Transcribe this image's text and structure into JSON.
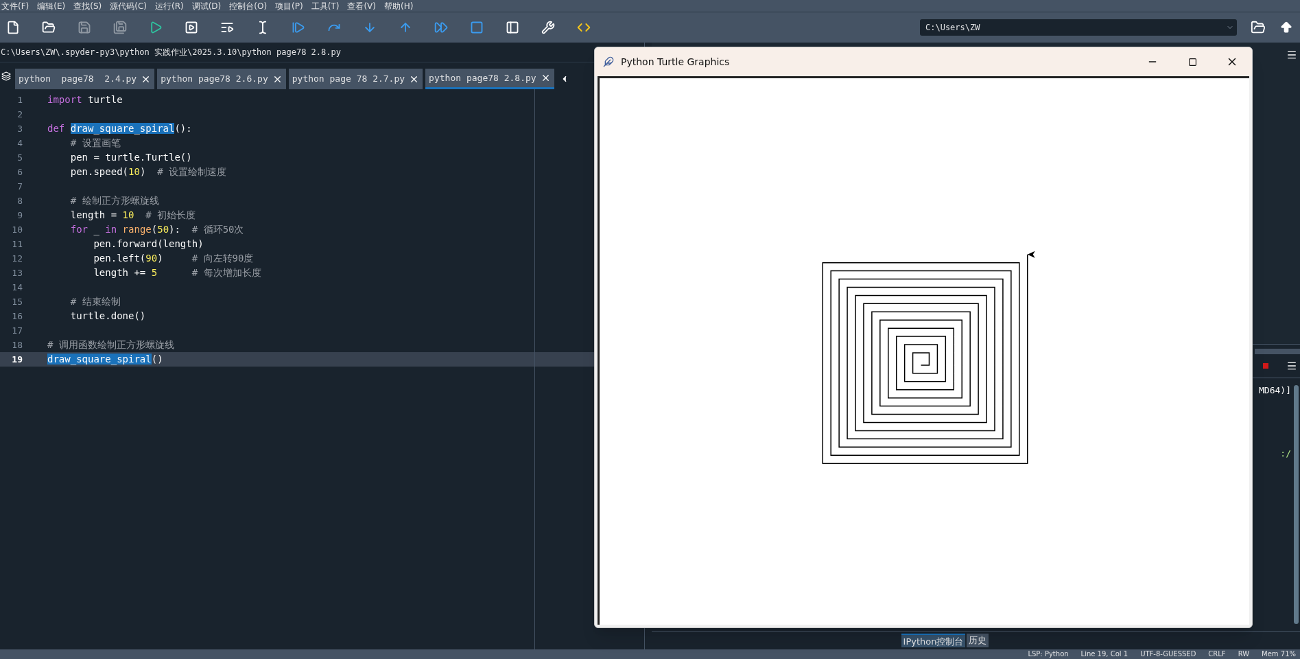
{
  "menu": [
    "文件(F)",
    "编辑(E)",
    "查找(S)",
    "源代码(C)",
    "运行(R)",
    "调试(D)",
    "控制台(O)",
    "项目(P)",
    "工具(T)",
    "查看(V)",
    "帮助(H)"
  ],
  "toolbar": [
    {
      "kind": "new-file",
      "disabled": false
    },
    {
      "kind": "open",
      "disabled": false
    },
    {
      "kind": "save",
      "disabled": true
    },
    {
      "kind": "save-all",
      "disabled": true
    },
    {
      "kind": "run",
      "disabled": false
    },
    {
      "kind": "run-cell",
      "disabled": false
    },
    {
      "kind": "run-cell-advance",
      "disabled": false
    },
    {
      "kind": "run-selection",
      "disabled": false
    },
    {
      "kind": "debug",
      "disabled": false
    },
    {
      "kind": "step-over",
      "disabled": false
    },
    {
      "kind": "step-into",
      "disabled": false
    },
    {
      "kind": "step-out",
      "disabled": false
    },
    {
      "kind": "continue",
      "disabled": false
    },
    {
      "kind": "stop",
      "disabled": false
    },
    {
      "kind": "maximize",
      "disabled": false
    },
    {
      "kind": "preferences",
      "disabled": false
    },
    {
      "kind": "python-path",
      "disabled": false
    }
  ],
  "working_directory": {
    "value": "C:\\Users\\ZW"
  },
  "file_path": "C:\\Users\\ZW\\.spyder-py3\\python 实践作业\\2025.3.10\\python page78 2.8.py",
  "editor_tabs": [
    {
      "label": "python  page78  2.4.py",
      "selected": false
    },
    {
      "label": "python page78 2.6.py",
      "selected": false
    },
    {
      "label": "python page 78 2.7.py",
      "selected": false
    },
    {
      "label": "python page78 2.8.py",
      "selected": true
    }
  ],
  "code_lines": [
    {
      "number": "1",
      "selected": false,
      "segments": [
        {
          "text": "import",
          "kind": "keyword"
        },
        {
          "text": " turtle",
          "kind": "plain"
        }
      ]
    },
    {
      "number": "2",
      "selected": false
    },
    {
      "number": "3",
      "selected": false,
      "segments": [
        {
          "text": "def ",
          "kind": "keyword"
        },
        {
          "text": "draw_square_spiral",
          "kind": "match"
        },
        {
          "text": "():",
          "kind": "plain"
        }
      ]
    },
    {
      "number": "4",
      "selected": false,
      "segments": [
        {
          "text": "    # 设置画笔",
          "kind": "comment"
        }
      ]
    },
    {
      "number": "5",
      "selected": false,
      "segments": [
        {
          "text": "    pen = turtle.Turtle()",
          "kind": "plain"
        }
      ]
    },
    {
      "number": "6",
      "selected": false,
      "segments": [
        {
          "text": "    pen.speed(",
          "kind": "plain"
        },
        {
          "text": "10",
          "kind": "number"
        },
        {
          "text": ")  ",
          "kind": "plain"
        },
        {
          "text": "# 设置绘制速度",
          "kind": "comment"
        }
      ]
    },
    {
      "number": "7",
      "selected": false
    },
    {
      "number": "8",
      "selected": false,
      "segments": [
        {
          "text": "    # 绘制正方形螺旋线",
          "kind": "comment"
        }
      ]
    },
    {
      "number": "9",
      "selected": false,
      "segments": [
        {
          "text": "    length = ",
          "kind": "plain"
        },
        {
          "text": "10",
          "kind": "number"
        },
        {
          "text": "  # 初始长度",
          "kind": "comment"
        }
      ]
    },
    {
      "number": "10",
      "selected": false,
      "segments": [
        {
          "text": "    for",
          "kind": "keyword"
        },
        {
          "text": " _ ",
          "kind": "plain"
        },
        {
          "text": "in ",
          "kind": "keyword"
        },
        {
          "text": "range",
          "kind": "builtin"
        },
        {
          "text": "(",
          "kind": "plain"
        },
        {
          "text": "50",
          "kind": "number"
        },
        {
          "text": "):  ",
          "kind": "plain"
        },
        {
          "text": "# 循环50次",
          "kind": "comment"
        }
      ]
    },
    {
      "number": "11",
      "selected": false,
      "segments": [
        {
          "text": "        pen.forward(length)",
          "kind": "plain"
        }
      ]
    },
    {
      "number": "12",
      "selected": false,
      "segments": [
        {
          "text": "        pen.left(",
          "kind": "plain"
        },
        {
          "text": "90",
          "kind": "number"
        },
        {
          "text": ")     ",
          "kind": "plain"
        },
        {
          "text": "# 向左转90度",
          "kind": "comment"
        }
      ]
    },
    {
      "number": "13",
      "selected": false,
      "segments": [
        {
          "text": "        length += ",
          "kind": "plain"
        },
        {
          "text": "5",
          "kind": "number"
        },
        {
          "text": "      # 每次增加长度",
          "kind": "comment"
        }
      ]
    },
    {
      "number": "14",
      "selected": false
    },
    {
      "number": "15",
      "selected": false,
      "segments": [
        {
          "text": "    # 结束绘制",
          "kind": "comment"
        }
      ]
    },
    {
      "number": "16",
      "selected": false,
      "segments": [
        {
          "text": "    turtle.done()",
          "kind": "plain"
        }
      ]
    },
    {
      "number": "17",
      "selected": false
    },
    {
      "number": "18",
      "selected": false,
      "segments": [
        {
          "text": "# 调用函数绘制正方形螺旋线",
          "kind": "comment"
        }
      ]
    },
    {
      "number": "19",
      "selected": true,
      "segments": [
        {
          "text": "draw_square_spiral",
          "kind": "match"
        },
        {
          "text": "()",
          "kind": "plain"
        }
      ]
    }
  ],
  "turtle_window": {
    "title": "Python Turtle Graphics"
  },
  "console": {
    "lines": [
      {
        "text": "MD64)]",
        "kind": "plain"
      },
      {
        "text": ":/",
        "kind": "string"
      }
    ]
  },
  "console_tabs": [
    {
      "label": "IPython控制台",
      "selected": true
    },
    {
      "label": "历史",
      "selected": false
    }
  ],
  "status_bar": [
    "LSP: Python",
    "Line 19, Col 1",
    "UTF-8-GUESSED",
    "CRLF",
    "RW",
    "Mem 71%"
  ]
}
